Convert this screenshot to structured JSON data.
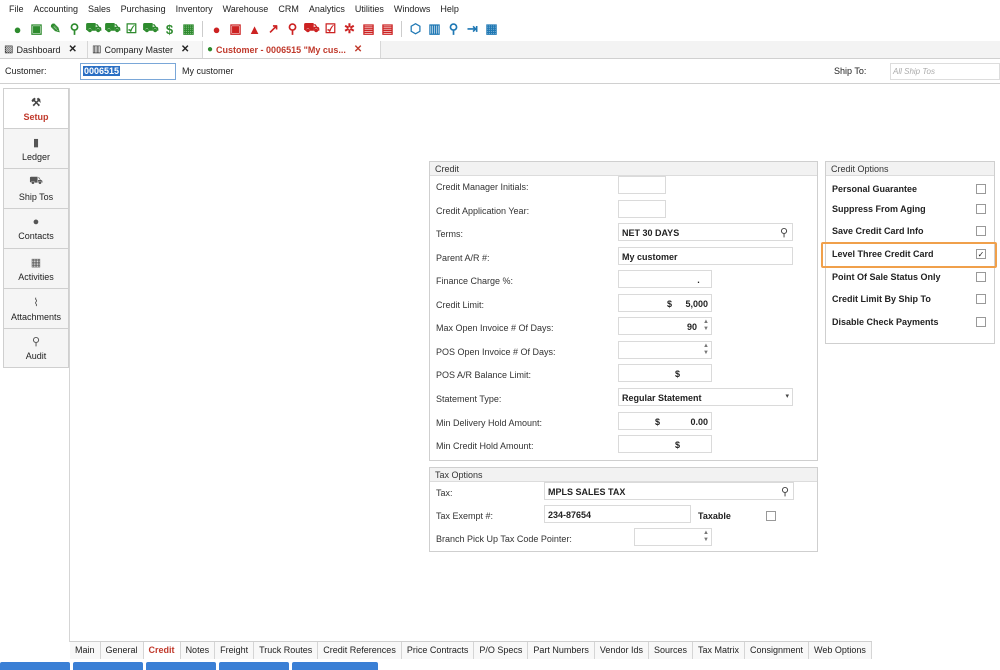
{
  "menu": [
    "File",
    "Accounting",
    "Sales",
    "Purchasing",
    "Inventory",
    "Warehouse",
    "CRM",
    "Analytics",
    "Utilities",
    "Windows",
    "Help"
  ],
  "doc_tabs": [
    {
      "label": "Dashboard",
      "close": "✕"
    },
    {
      "label": "Company Master",
      "close": "✕"
    },
    {
      "label": "Customer - 0006515 \"My cus...",
      "close": "✕"
    }
  ],
  "customer": {
    "label": "Customer:",
    "value": "0006515",
    "name": "My customer",
    "ship_to_label": "Ship To:",
    "ship_to_placeholder": "All Ship Tos"
  },
  "side_nav": [
    "Setup",
    "Ledger",
    "Ship Tos",
    "Contacts",
    "Activities",
    "Attachments",
    "Audit"
  ],
  "credit": {
    "title": "Credit",
    "fields": {
      "credit_manager_initials": {
        "label": "Credit Manager Initials:",
        "value": ""
      },
      "credit_application_year": {
        "label": "Credit Application Year:",
        "value": ""
      },
      "terms": {
        "label": "Terms:",
        "value": "NET 30 DAYS"
      },
      "parent_ar": {
        "label": "Parent A/R #:",
        "value": "My customer"
      },
      "finance_charge": {
        "label": "Finance Charge %:",
        "value": "."
      },
      "credit_limit": {
        "label": "Credit Limit:",
        "currency": "$",
        "value": "5,000"
      },
      "max_open_invoice_days": {
        "label": "Max Open Invoice # Of Days:",
        "value": "90"
      },
      "pos_open_invoice_days": {
        "label": "POS Open Invoice # Of Days:",
        "value": ""
      },
      "pos_ar_balance_limit": {
        "label": "POS A/R Balance Limit:",
        "value": "$"
      },
      "statement_type": {
        "label": "Statement Type:",
        "value": "Regular Statement"
      },
      "min_delivery_hold": {
        "label": "Min Delivery Hold Amount:",
        "currency": "$",
        "value": "0.00"
      },
      "min_credit_hold": {
        "label": "Min Credit Hold Amount:",
        "value": "$"
      }
    }
  },
  "tax": {
    "title": "Tax Options",
    "tax_label": "Tax:",
    "tax_value": "MPLS SALES TAX",
    "exempt_label": "Tax Exempt #:",
    "exempt_value": "234-87654",
    "taxable_label": "Taxable",
    "branch_label": "Branch Pick Up Tax Code Pointer:"
  },
  "credit_options": {
    "title": "Credit Options",
    "items": [
      {
        "label": "Personal Guarantee",
        "checked": false
      },
      {
        "label": "Suppress From Aging",
        "checked": false
      },
      {
        "label": "Save Credit Card Info",
        "checked": false
      },
      {
        "label": "Level Three Credit Card",
        "checked": true
      },
      {
        "label": "Point Of Sale Status Only",
        "checked": false
      },
      {
        "label": "Credit Limit By Ship To",
        "checked": false
      },
      {
        "label": "Disable Check Payments",
        "checked": false
      }
    ],
    "check_mark": "✓"
  },
  "bottom_tabs": [
    "Main",
    "General",
    "Credit",
    "Notes",
    "Freight",
    "Truck Routes",
    "Credit References",
    "Price Contracts",
    "P/O Specs",
    "Part Numbers",
    "Vendor Ids",
    "Sources",
    "Tax Matrix",
    "Consignment",
    "Web Options"
  ],
  "active_bottom_tab": "Credit"
}
